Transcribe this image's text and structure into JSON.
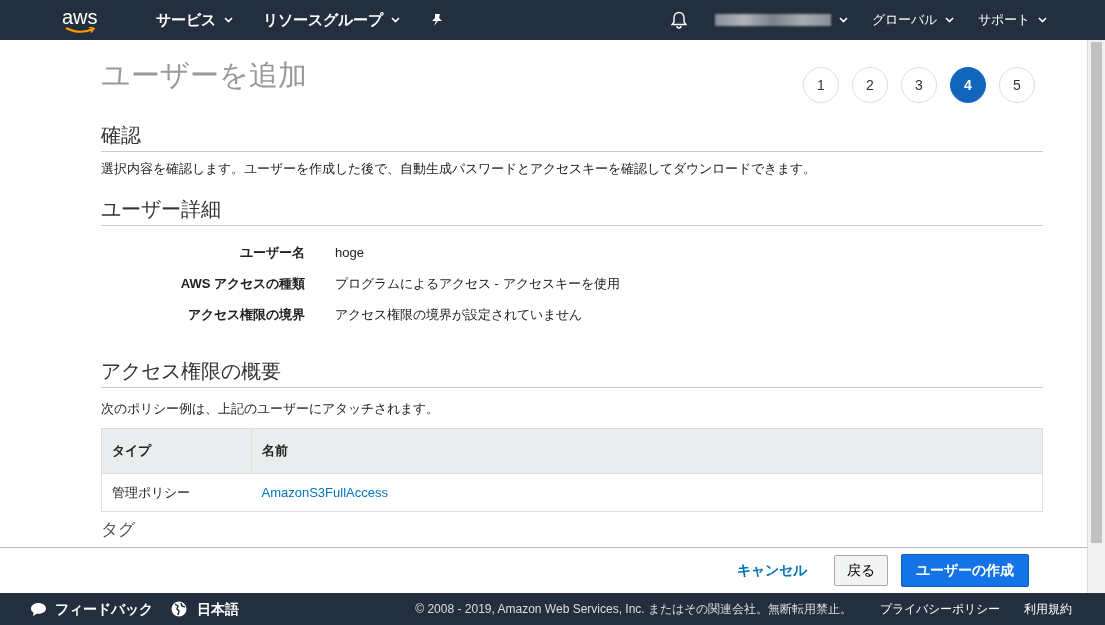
{
  "navbar": {
    "logo": "aws",
    "menus": [
      {
        "label": "サービス"
      },
      {
        "label": "リソースグループ"
      }
    ],
    "right_menus": [
      {
        "label": "グローバル"
      },
      {
        "label": "サポート"
      }
    ]
  },
  "page": {
    "title": "ユーザーを追加",
    "steps": [
      {
        "label": "1",
        "selected": false
      },
      {
        "label": "2",
        "selected": false
      },
      {
        "label": "3",
        "selected": false
      },
      {
        "label": "4",
        "selected": true
      },
      {
        "label": "5",
        "selected": false
      }
    ],
    "review": {
      "heading": "確認",
      "description": "選択内容を確認します。ユーザーを作成した後で、自動生成パスワードとアクセスキーを確認してダウンロードできます。"
    },
    "user_details": {
      "heading": "ユーザー詳細",
      "rows": [
        {
          "label": "ユーザー名",
          "value": "hoge"
        },
        {
          "label": "AWS アクセスの種類",
          "value": "プログラムによるアクセス - アクセスキーを使用"
        },
        {
          "label": "アクセス権限の境界",
          "value": "アクセス権限の境界が設定されていません"
        }
      ]
    },
    "permissions": {
      "heading": "アクセス権限の概要",
      "description": "次のポリシー例は、上記のユーザーにアタッチされます。",
      "table": {
        "columns": [
          "タイプ",
          "名前"
        ],
        "rows": [
          [
            "管理ポリシー",
            "AmazonS3FullAccess"
          ]
        ]
      }
    },
    "tags": {
      "heading": "タグ"
    }
  },
  "actions": {
    "cancel": "キャンセル",
    "back": "戻る",
    "create": "ユーザーの作成"
  },
  "footer": {
    "feedback": "フィードバック",
    "language": "日本語",
    "copyright": "© 2008 - 2019, Amazon Web Services, Inc. またはその関連会社。無断転用禁止。",
    "links": [
      "プライバシーポリシー",
      "利用規約"
    ]
  }
}
